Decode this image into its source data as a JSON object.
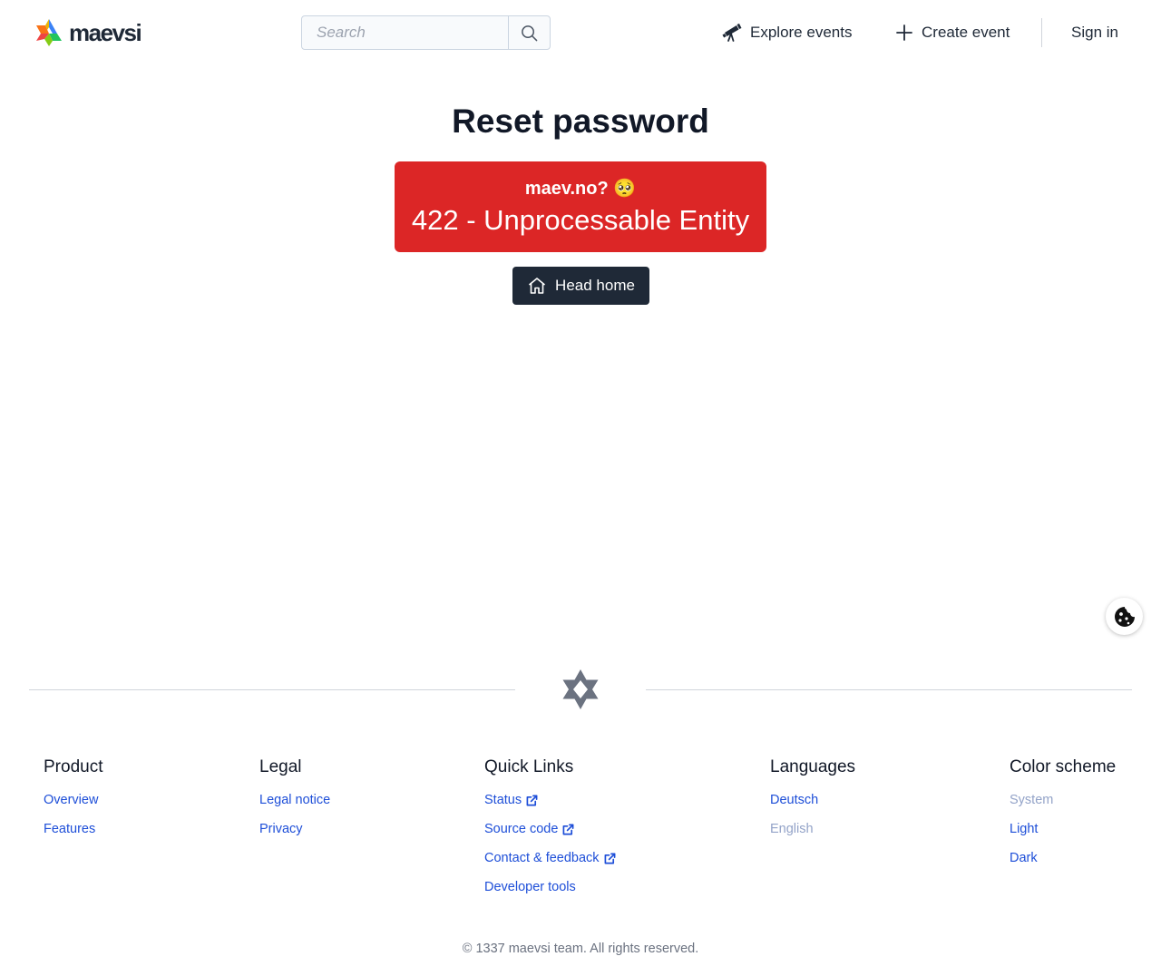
{
  "header": {
    "logo_text": "maevsi",
    "search": {
      "placeholder": "Search"
    },
    "nav": {
      "explore": "Explore events",
      "create": "Create event",
      "signin": "Sign in"
    }
  },
  "main": {
    "title": "Reset password",
    "error": {
      "host": "maev.no? 🥺",
      "code": "422 - Unprocessable Entity"
    },
    "home_button": "Head home"
  },
  "footer": {
    "product": {
      "heading": "Product",
      "links": [
        "Overview",
        "Features"
      ]
    },
    "legal": {
      "heading": "Legal",
      "links": [
        "Legal notice",
        "Privacy"
      ]
    },
    "quick_links": {
      "heading": "Quick Links",
      "links": [
        "Status",
        "Source code",
        "Contact & feedback",
        "Developer tools"
      ]
    },
    "languages": {
      "heading": "Languages",
      "links": [
        "Deutsch",
        "English"
      ],
      "active": "English"
    },
    "color_scheme": {
      "heading": "Color scheme",
      "links": [
        "System",
        "Light",
        "Dark"
      ],
      "active": "System"
    },
    "copyright": "© 1337 maevsi team. All rights reserved."
  },
  "colors": {
    "error_background": "#dc2626",
    "button_dark": "#1f2937",
    "link": "#1d4ed8"
  },
  "icons": [
    "logo-star",
    "search-icon",
    "telescope-icon",
    "plus-icon",
    "home-icon",
    "cookie-icon",
    "external-link-icon",
    "footer-star-icon"
  ]
}
